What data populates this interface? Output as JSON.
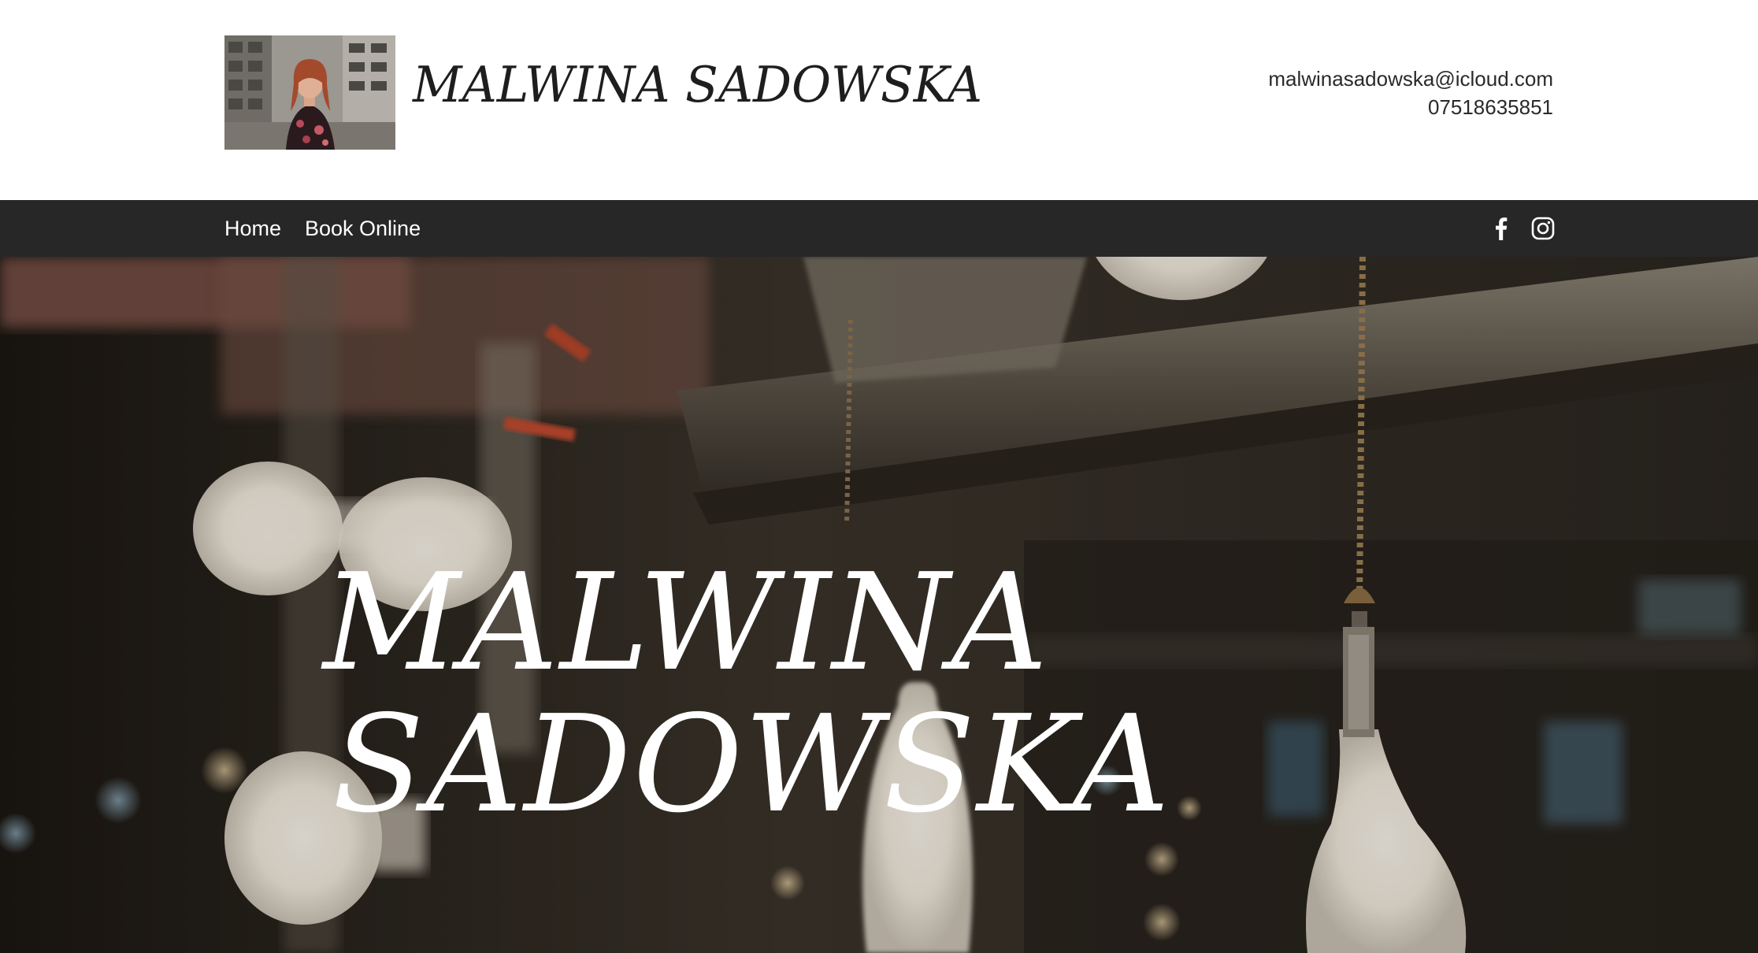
{
  "header": {
    "site_title": "MALWINA SADOWSKA",
    "email": "malwinasadowska@icloud.com",
    "phone": "07518635851"
  },
  "nav": {
    "items": [
      {
        "label": "Home"
      },
      {
        "label": "Book Online"
      }
    ],
    "social": [
      {
        "icon": "facebook-icon"
      },
      {
        "icon": "instagram-icon"
      }
    ]
  },
  "hero": {
    "title_line1": "MALWINA",
    "title_line2": "SADOWSKA"
  },
  "colors": {
    "nav_background": "#272727",
    "header_background": "#ffffff",
    "title_text": "#1e1e1e",
    "hero_text": "#ffffff"
  }
}
